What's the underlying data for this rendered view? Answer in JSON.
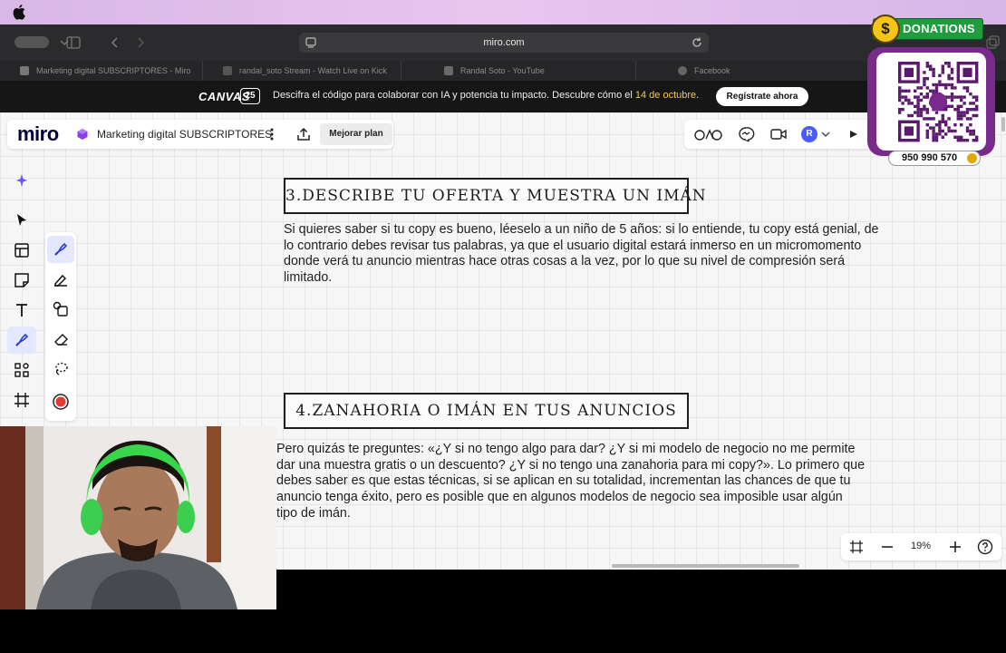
{
  "browser": {
    "url": "miro.com",
    "tabs": [
      {
        "label": "Marketing digital SUBSCRIPTORES - Miro",
        "icon": "miro-tab-icon"
      },
      {
        "label": "randal_soto Stream - Watch Live on Kick",
        "icon": "kick-tab-icon"
      },
      {
        "label": "Randal Soto - YouTube",
        "icon": "youtube-tab-icon"
      },
      {
        "label": "Facebook",
        "icon": "facebook-tab-icon"
      }
    ]
  },
  "banner": {
    "logo": "CANVAS",
    "badge": "25",
    "text": "Descifra el código para colaborar con IA y potencia tu impacto. Descubre cómo el",
    "date": "14 de octubre",
    "cta": "Regístrate ahora"
  },
  "miro": {
    "logo": "miro",
    "board_name": "Marketing digital SUBSCRIPTORES",
    "upgrade_label": "Mejorar plan",
    "avatar_initial": "R",
    "zoom": "19%"
  },
  "content": {
    "heading3": "3.Describe tu oferta y muestra un imán",
    "para3": "Si quieres saber si tu copy es bueno, léeselo a un niño de 5 años: si lo entiende, tu copy está genial, de lo contrario debes revisar tus palabras, ya que el usuario digital estará inmerso en un micromomento donde verá tu anuncio mientras hace otras cosas a la vez, por lo que su nivel de compresión será limitado.",
    "heading4": "4.Zanahoria o imán en tus anuncios",
    "para4": "Pero quizás te preguntes: «¿Y si no tengo algo para dar? ¿Y si mi modelo de negocio no me permite dar una muestra gratis o un descuento? ¿Y si no tengo una zanahoria para mi copy?». Lo primero que debes saber es que estas técnicas, si se aplican en su totalidad, incrementan las chances de que tu anuncio tenga éxito, pero es posible que en algunos modelos de negocio sea imposible usar algún tipo de imán."
  },
  "donations": {
    "label": "DONATIONS",
    "coin": "$",
    "phone": "950 990 570"
  },
  "colors": {
    "accent": "#4a5cff",
    "donate_green": "#1f9c3e",
    "yape_purple": "#7a2a8c",
    "banner_date": "#f2c94c"
  }
}
